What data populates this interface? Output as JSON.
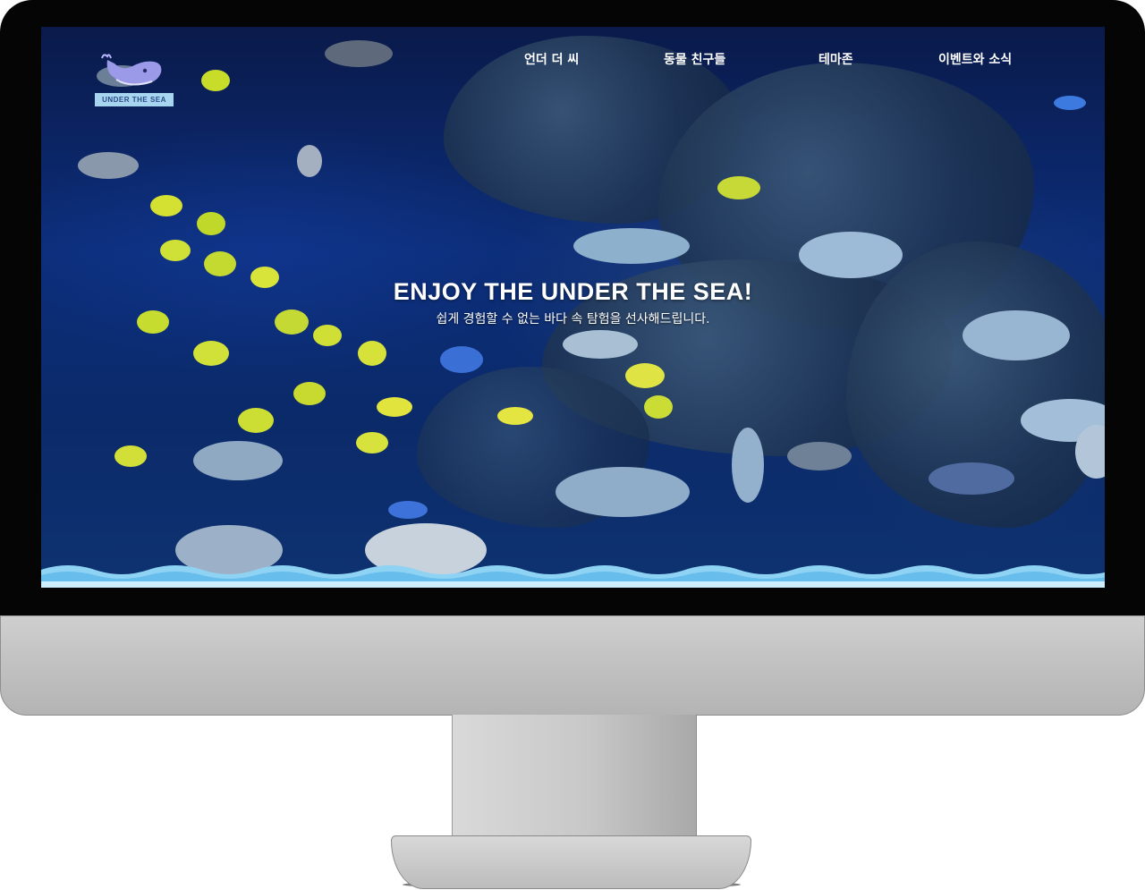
{
  "logo": {
    "text": "UNDER THE SEA",
    "icon": "whale-icon"
  },
  "nav": {
    "items": [
      {
        "label": "언더 더 씨"
      },
      {
        "label": "동물 친구들"
      },
      {
        "label": "테마존"
      },
      {
        "label": "이벤트와 소식"
      }
    ]
  },
  "hero": {
    "title": "ENJOY THE UNDER THE SEA!",
    "subtitle": "쉽게 경험할 수 없는 바다 속 탐험을 선사해드립니다."
  },
  "colors": {
    "logo_band": "#a7d4ee",
    "whale": "#9a9ae8",
    "water": "#0c2e7a",
    "wave": "#8fd3f4"
  }
}
